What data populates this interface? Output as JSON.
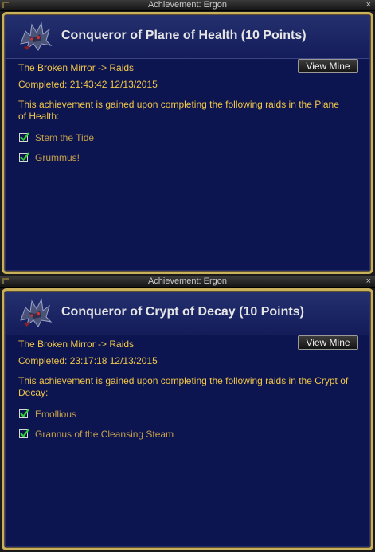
{
  "windows": [
    {
      "window_title": "Achievement: Ergon",
      "close_glyph": "×",
      "achievement_title": "Conqueror of Plane of Health (10 Points)",
      "category": "The Broken Mirror -> Raids",
      "completed": "Completed: 21:43:42  12/13/2015",
      "view_button": "View Mine",
      "description": "This achievement is gained upon completing the following raids in the Plane of Health:",
      "requirements": [
        {
          "label": "Stem the Tide",
          "checked": true
        },
        {
          "label": "Grummus!",
          "checked": true
        }
      ],
      "icon": "dragon-emblem-icon"
    },
    {
      "window_title": "Achievement: Ergon",
      "close_glyph": "×",
      "achievement_title": "Conqueror of Crypt of Decay (10 Points)",
      "category": "The Broken Mirror -> Raids",
      "completed": "Completed: 23:17:18  12/13/2015",
      "view_button": "View Mine",
      "description": "This achievement is gained upon completing the following raids in the Crypt of Decay:",
      "requirements": [
        {
          "label": "Emollious",
          "checked": true
        },
        {
          "label": "Grannus of the Cleansing Steam",
          "checked": true
        }
      ],
      "icon": "dragon-emblem-icon"
    }
  ],
  "colors": {
    "panel_bg": "#0d1550",
    "gold_text": "#f0c64a",
    "frame_gold": "#c9b05a",
    "check_green": "#2fd12f"
  }
}
